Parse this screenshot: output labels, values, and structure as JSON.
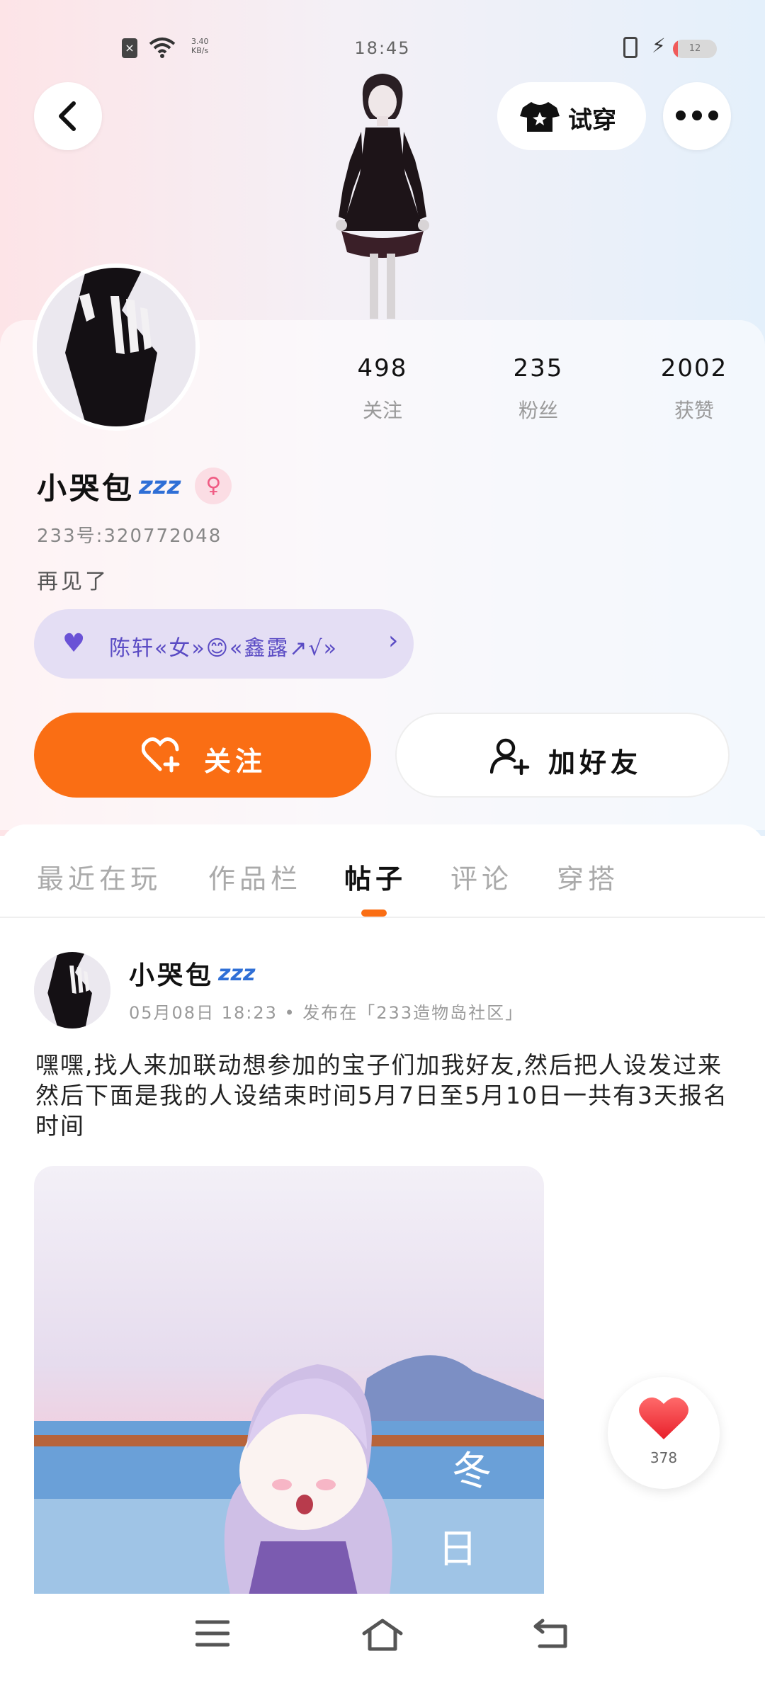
{
  "status_bar": {
    "time": "18:45",
    "net_speed_value": "3.40",
    "net_speed_unit": "KB/s",
    "battery": "12",
    "battery_fraction": 0.12
  },
  "header": {
    "tryon_label": "试穿"
  },
  "profile": {
    "stats": [
      {
        "value": "498",
        "label": "关注"
      },
      {
        "value": "235",
        "label": "粉丝"
      },
      {
        "value": "2002",
        "label": "获赞"
      }
    ],
    "name": "小哭包",
    "name_badge": "zzz",
    "gender_symbol": "♀",
    "uid": "233号:320772048",
    "bio": "再见了",
    "relation_text": "陈轩«女»😊«鑫露↗√»",
    "follow_label": "关注",
    "add_friend_label": "加好友"
  },
  "tabs": [
    {
      "label": "最近在玩"
    },
    {
      "label": "作品栏"
    },
    {
      "label": "帖子"
    },
    {
      "label": "评论"
    },
    {
      "label": "穿搭"
    }
  ],
  "active_tab": "帖子",
  "post": {
    "author": "小哭包",
    "author_badge": "zzz",
    "meta": "05月08日 18:23 • 发布在「233造物岛社区」",
    "text": "嘿嘿,找人来加联动想参加的宝子们加我好友,然后把人设发过来然后下面是我的人设结束时间5月7日至5月10日一共有3天报名时间",
    "like_count": "378"
  },
  "colors": {
    "accent": "#fa6e14",
    "relation_bg": "#e4def4",
    "relation_text": "#5a4bc4",
    "badge_blue": "#2f6fd6"
  }
}
